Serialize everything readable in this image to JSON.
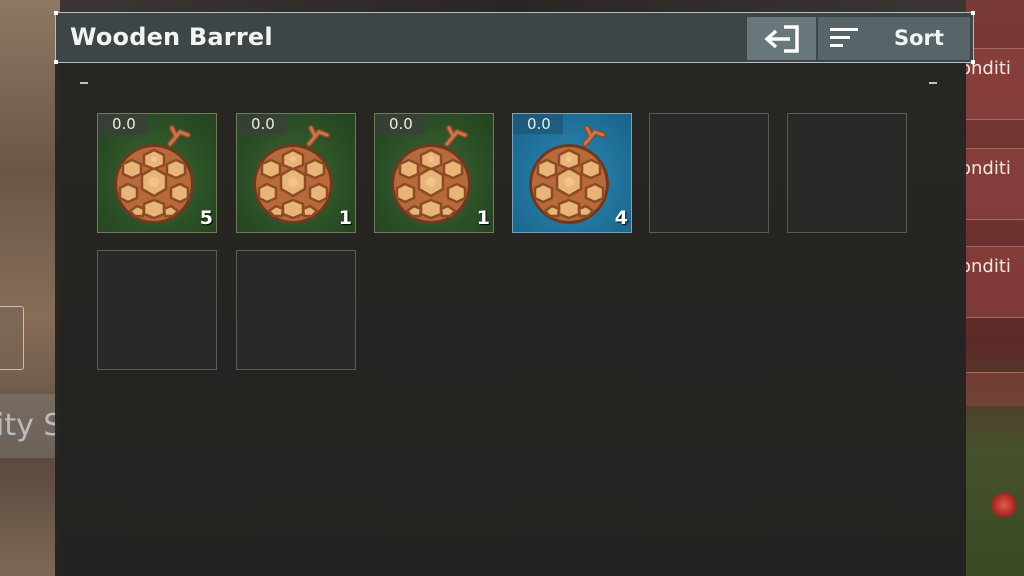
{
  "container": {
    "title": "Wooden Barrel",
    "sort_label": "Sort"
  },
  "slots": [
    {
      "value_tag": "0.0",
      "quantity": "5",
      "item_icon": "cake-ball-icon",
      "rarity": "common"
    },
    {
      "value_tag": "0.0",
      "quantity": "1",
      "item_icon": "cake-ball-icon",
      "rarity": "common"
    },
    {
      "value_tag": "0.0",
      "quantity": "1",
      "item_icon": "cake-ball-icon",
      "rarity": "common"
    },
    {
      "value_tag": "0.0",
      "quantity": "4",
      "item_icon": "cake-ball-icon",
      "rarity": "rare"
    },
    {
      "empty": true
    },
    {
      "empty": true
    },
    {
      "empty": true
    },
    {
      "empty": true
    }
  ],
  "background": {
    "left_text": "ity S",
    "right_rows": [
      "onditi",
      "onditi",
      "onditi"
    ]
  },
  "colors": {
    "header_bg": "#3e4547",
    "common_slot": "#2b4f26",
    "rare_slot": "#20729b"
  }
}
